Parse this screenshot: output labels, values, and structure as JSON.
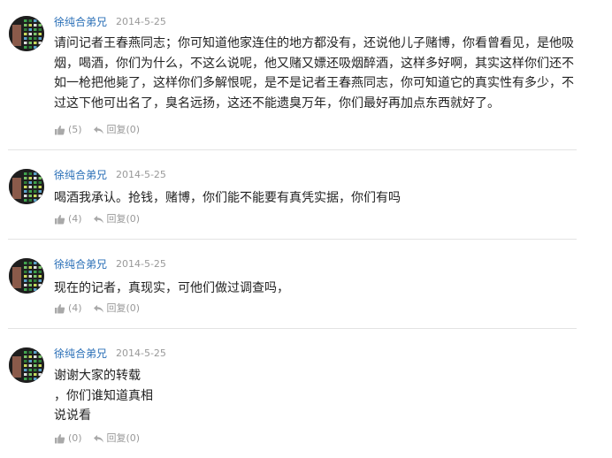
{
  "colors": {
    "username": "#2a6fb7",
    "meta": "#999999",
    "divider": "#e3e3e3",
    "text": "#222222"
  },
  "comments": [
    {
      "username": "徐纯合弟兄",
      "date": "2014-5-25",
      "lines": [
        "请问记者王春燕同志；你可知道他家连住的地方都没有，还说他儿子赌博，你看曾看见，是他吸",
        "烟，喝酒，你们为什么，不这么说呢，他又赌又嫖还吸烟醉酒，这样多好啊，其实这样你们还不",
        "如一枪把他毙了，这样你们多解恨呢，是不是记者王春燕同志，你可知道它的真实性有多少，不",
        "过这下他可出名了，臭名远扬，这还不能遗臭万年，你们最好再加点东西就好了。"
      ],
      "likes": "(5)",
      "reply": "回复(0)",
      "avatar_icon": "avatar-icon",
      "like_icon": "thumbs-up-icon",
      "reply_icon": "reply-arrow-icon"
    },
    {
      "username": "徐纯合弟兄",
      "date": "2014-5-25",
      "lines": [
        "喝酒我承认。抢钱，赌博，你们能不能要有真凭实据，你们有吗"
      ],
      "likes": "(4)",
      "reply": "回复(0)"
    },
    {
      "username": "徐纯合弟兄",
      "date": "2014-5-25",
      "lines": [
        "现在的记者，真现实，可他们做过调查吗，"
      ],
      "likes": "(4)",
      "reply": "回复(0)"
    },
    {
      "username": "徐纯合弟兄",
      "date": "2014-5-25",
      "lines": [
        "谢谢大家的转载",
        "，你们谁知道真相",
        "说说看"
      ],
      "likes": "(0)",
      "reply": "回复(0)"
    }
  ]
}
